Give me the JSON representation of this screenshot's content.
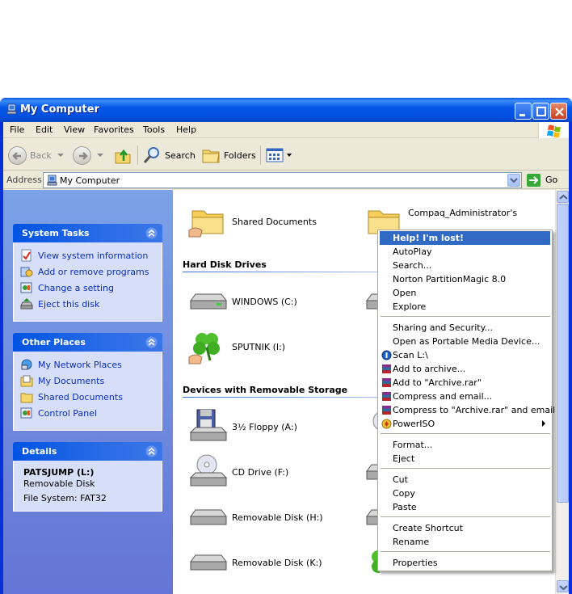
{
  "window": {
    "title": "My Computer"
  },
  "menubar": {
    "items": [
      "File",
      "Edit",
      "View",
      "Favorites",
      "Tools",
      "Help"
    ]
  },
  "toolbar": {
    "back_label": "Back",
    "search_label": "Search",
    "folders_label": "Folders"
  },
  "address": {
    "label": "Address",
    "value": "My Computer",
    "go_label": "Go"
  },
  "system_tasks": {
    "title": "System Tasks",
    "items": [
      "View system information",
      "Add or remove programs",
      "Change a setting",
      "Eject this disk"
    ]
  },
  "other_places": {
    "title": "Other Places",
    "items": [
      "My Network Places",
      "My Documents",
      "Shared Documents",
      "Control Panel"
    ]
  },
  "details": {
    "title": "Details",
    "name": "PATSJUMP (L:)",
    "type": "Removable Disk",
    "filesystem": "File System: FAT32"
  },
  "files": {
    "shared_documents": "Shared Documents",
    "admin_documents": "Compaq_Administrator's"
  },
  "hard_disks": {
    "header": "Hard Disk Drives",
    "items": [
      "WINDOWS (C:)",
      "SPUTNIK (I:)"
    ]
  },
  "removable": {
    "header": "Devices with Removable Storage",
    "items": [
      "3½ Floppy (A:)",
      "CD Drive (F:)",
      "Removable Disk (H:)",
      "Removable Disk (K:)"
    ]
  },
  "context_menu": {
    "items": [
      "Help! I'm lost!",
      "AutoPlay",
      "Search...",
      "Norton PartitionMagic 8.0",
      "Open",
      "Explore",
      "Sharing and Security...",
      "Open as Portable Media Device...",
      "Scan L:\\",
      "Add to archive...",
      "Add to \"Archive.rar\"",
      "Compress and email...",
      "Compress to \"Archive.rar\" and email",
      "PowerISO",
      "Format...",
      "Eject",
      "Cut",
      "Copy",
      "Paste",
      "Create Shortcut",
      "Rename",
      "Properties"
    ]
  },
  "colors": {
    "titlebar": "#0054e3",
    "menu_highlight": "#316ac5",
    "task_link": "#0c2ec0"
  }
}
